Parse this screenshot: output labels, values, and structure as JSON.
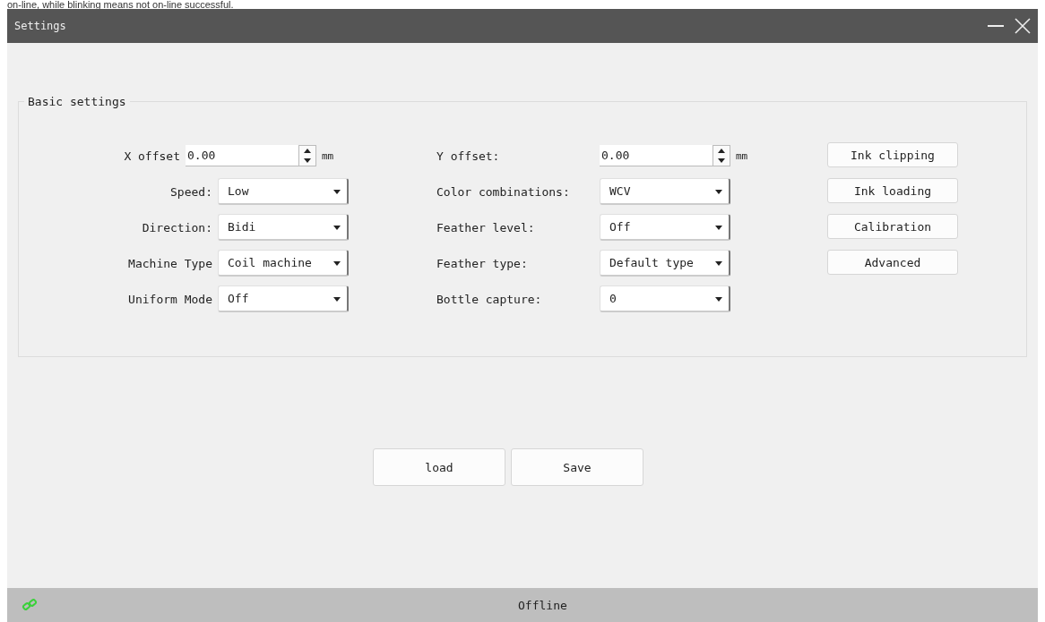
{
  "page_caption": "on-line, while blinking means not on-line successful.",
  "window": {
    "title": "Settings"
  },
  "group": {
    "title": "Basic settings"
  },
  "left_fields": [
    {
      "label": "X offset",
      "kind": "spin",
      "value": "0.00",
      "unit": "mm"
    },
    {
      "label": "Speed:",
      "kind": "combo",
      "value": "Low"
    },
    {
      "label": "Direction:",
      "kind": "combo",
      "value": "Bidi"
    },
    {
      "label": "Machine Type",
      "kind": "combo",
      "value": "Coil machine"
    },
    {
      "label": "Uniform Mode",
      "kind": "combo",
      "value": "Off"
    }
  ],
  "right_fields": [
    {
      "label": "Y offset:",
      "kind": "spin",
      "value": "0.00",
      "unit": "mm"
    },
    {
      "label": "Color combinations:",
      "kind": "combo",
      "value": "WCV"
    },
    {
      "label": "Feather level:",
      "kind": "combo",
      "value": "Off"
    },
    {
      "label": "Feather type:",
      "kind": "combo",
      "value": "Default type"
    },
    {
      "label": "Bottle capture:",
      "kind": "combo",
      "value": "0"
    }
  ],
  "side_buttons": [
    "Ink clipping",
    "Ink loading",
    "Calibration",
    "Advanced"
  ],
  "bottom_buttons": [
    "load",
    "Save"
  ],
  "status_bar": {
    "text": "Offline"
  }
}
